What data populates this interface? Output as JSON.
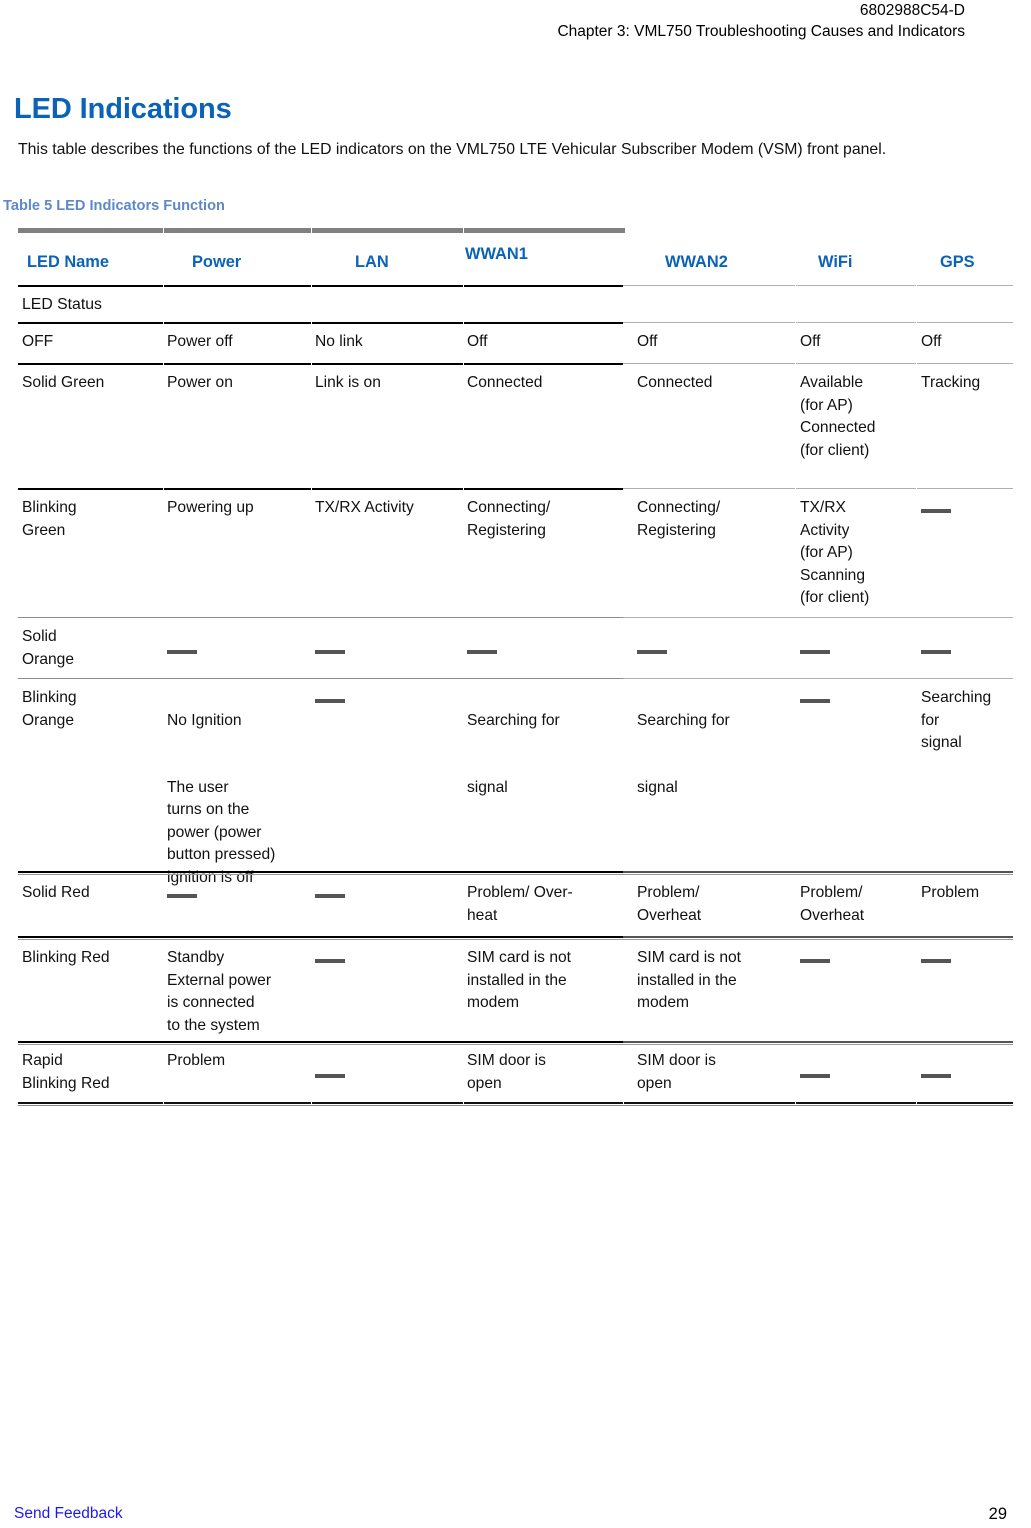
{
  "header": {
    "doc_number": "6802988C54-D",
    "chapter_line": "Chapter 3:  VML750 Troubleshooting Causes and Indicators"
  },
  "section": {
    "heading": "LED Indications",
    "intro": "This table describes the functions of the LED indicators on the VML750 LTE Vehicular Subscriber Modem (VSM) front panel."
  },
  "table": {
    "caption": "Table 5  LED Indicators Function",
    "columns": [
      "LED Name",
      "Power",
      "LAN",
      "WWAN1",
      "WWAN2",
      "WiFi",
      "GPS"
    ],
    "status_band_label": "LED Status",
    "dash": "—",
    "rows": [
      {
        "name": "OFF",
        "power": "Power off",
        "lan": "No link",
        "wwan1": "Off",
        "wwan2": "Off",
        "wifi": "Off",
        "gps": "Off"
      },
      {
        "name": "Solid Green",
        "power": "Power on",
        "lan": "Link is on",
        "wwan1": "Connected",
        "wwan2": "Connected",
        "wifi": "Available\n(for AP)\nConnected\n(for client)",
        "gps": "Tracking"
      },
      {
        "name": "Blinking\nGreen",
        "power": "Powering up",
        "lan": "TX/RX Activity",
        "wwan1": "Connecting/\nRegistering",
        "wwan2": "Connecting/\nRegistering",
        "wifi": "TX/RX\nActivity\n(for AP)\nScanning\n(for client)",
        "gps": "—"
      },
      {
        "name": "Solid\nOrange",
        "power": "—",
        "lan": "—",
        "wwan1": "—",
        "wwan2": "—",
        "wifi": "—",
        "gps": "—"
      },
      {
        "name": "Blinking\nOrange",
        "power_p1": "No Ignition",
        "power_p2": "The user\nturns on the\npower (power\nbutton pressed)\n ignition is off",
        "lan": "—",
        "wwan1_p1": "Searching for",
        "wwan1_p2": "signal",
        "wwan2_p1": "Searching for",
        "wwan2_p2": "signal",
        "wifi": "—",
        "gps": "Searching\nfor\nsignal"
      },
      {
        "name": "Solid Red",
        "power": "—",
        "lan": "—",
        "wwan1": "Problem/ Over-\nheat",
        "wwan2": "Problem/\nOverheat",
        "wifi": "Problem/\nOverheat",
        "gps": "Problem"
      },
      {
        "name": "Blinking Red",
        "power": "Standby\nExternal power\nis connected\nto the system",
        "lan": "—",
        "wwan1": "SIM card is not\ninstalled in the\nmodem",
        "wwan2": "SIM card is not\ninstalled in the\nmodem",
        "wifi": "—",
        "gps": "—"
      },
      {
        "name": "Rapid\nBlinking Red",
        "power": "Problem",
        "lan": "—",
        "wwan1": "SIM door is\nopen",
        "wwan2": "SIM door is\nopen",
        "wifi": "—",
        "gps": "—"
      }
    ]
  },
  "footer": {
    "feedback_label": "Send Feedback",
    "page_number": "29"
  },
  "colors": {
    "heading_blue": "#0b63b8",
    "caption_blue": "#5d8ac6",
    "link_blue": "#1a1aee",
    "rule_grey": "#808080",
    "dash_grey": "#555555"
  }
}
